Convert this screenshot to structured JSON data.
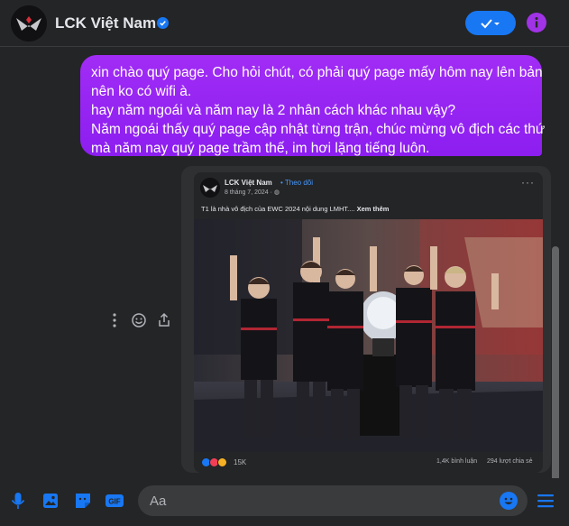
{
  "header": {
    "title": "LCK Việt Nam",
    "verified_icon": "verified-badge-icon",
    "action_icon": "check-dropdown-icon",
    "info_icon": "info-icon"
  },
  "message": {
    "lines": [
      "xin chào quý page. Cho hỏi chút, có phải quý page mấy hôm nay lên bản",
      "nên ko có wifi à.",
      "hay năm ngoái và năm nay là 2 nhân cách khác nhau vậy?",
      "Năm ngoái thấy quý page cập nhật từng trận, chúc mừng vô địch các thứ",
      "mà năm nay quý page trầm thế, im hơi lặng tiếng luôn."
    ]
  },
  "shared_post": {
    "page_name": "LCK Việt Nam",
    "follow_label": "• Theo dõi",
    "date": "8 tháng 7, 2024 · ",
    "text": "T1 là nhà vô địch của EWC 2024 nội dung LMHT.... ",
    "see_more": "Xem thêm",
    "more_label": "···",
    "reaction_count": "15K",
    "comments": "1,4K bình luận",
    "shares": "294 lượt chia sẻ"
  },
  "composer": {
    "placeholder": "Aa"
  },
  "colors": {
    "bubble": "#9b17f7",
    "accent": "#1877f2",
    "background": "#242526"
  }
}
